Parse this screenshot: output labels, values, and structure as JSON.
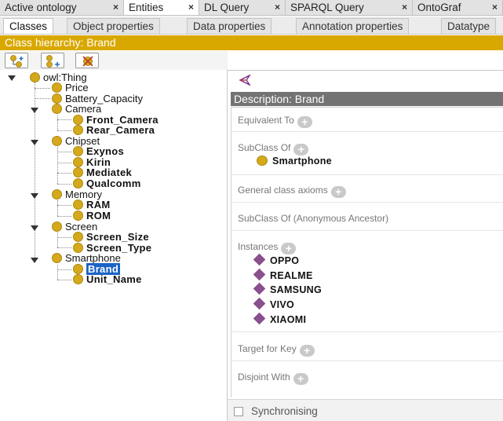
{
  "tabs": [
    {
      "label": "Active ontology",
      "close": "×"
    },
    {
      "label": "Entities",
      "close": "×"
    },
    {
      "label": "DL Query",
      "close": "×"
    },
    {
      "label": "SPARQL Query",
      "close": "×"
    },
    {
      "label": "OntoGraf",
      "close": "×"
    }
  ],
  "subtabs": [
    "Classes",
    "Object properties",
    "Data properties",
    "Annotation properties",
    "Datatype"
  ],
  "hierarchy": {
    "title": "Class hierarchy: Brand",
    "tree": {
      "root": "owl:Thing",
      "price": "Price",
      "battery": "Battery_Capacity",
      "camera": "Camera",
      "front_camera": "Front_Camera",
      "rear_camera": "Rear_Camera",
      "chipset": "Chipset",
      "exynos": "Exynos",
      "kirin": "Kirin",
      "mediatek": "Mediatek",
      "qualcomm": "Qualcomm",
      "memory": "Memory",
      "ram": "RAM",
      "rom": "ROM",
      "screen": "Screen",
      "screen_size": "Screen_Size",
      "screen_type": "Screen_Type",
      "smartphone": "Smartphone",
      "brand": "Brand",
      "unit_name": "Unit_Name"
    }
  },
  "description": {
    "title": "Description: Brand",
    "equivalent_to": "Equivalent To",
    "subclass_of": "SubClass Of",
    "subclass_entry": "Smartphone",
    "general_axioms": "General class axioms",
    "anonymous_ancestor": "SubClass Of (Anonymous Ancestor)",
    "instances_label": "Instances",
    "instances": [
      "OPPO",
      "REALME",
      "SAMSUNG",
      "VIVO",
      "XIAOMI"
    ],
    "target_for_key": "Target for Key",
    "disjoint_with": "Disjoint With",
    "plus": "+"
  },
  "sync": {
    "label": "Synchronising",
    "checked": false
  },
  "colors": {
    "accent": "#d9a800",
    "class_dot": "#d4a91c",
    "individual": "#8a4f8d",
    "selection": "#1c63c6"
  }
}
